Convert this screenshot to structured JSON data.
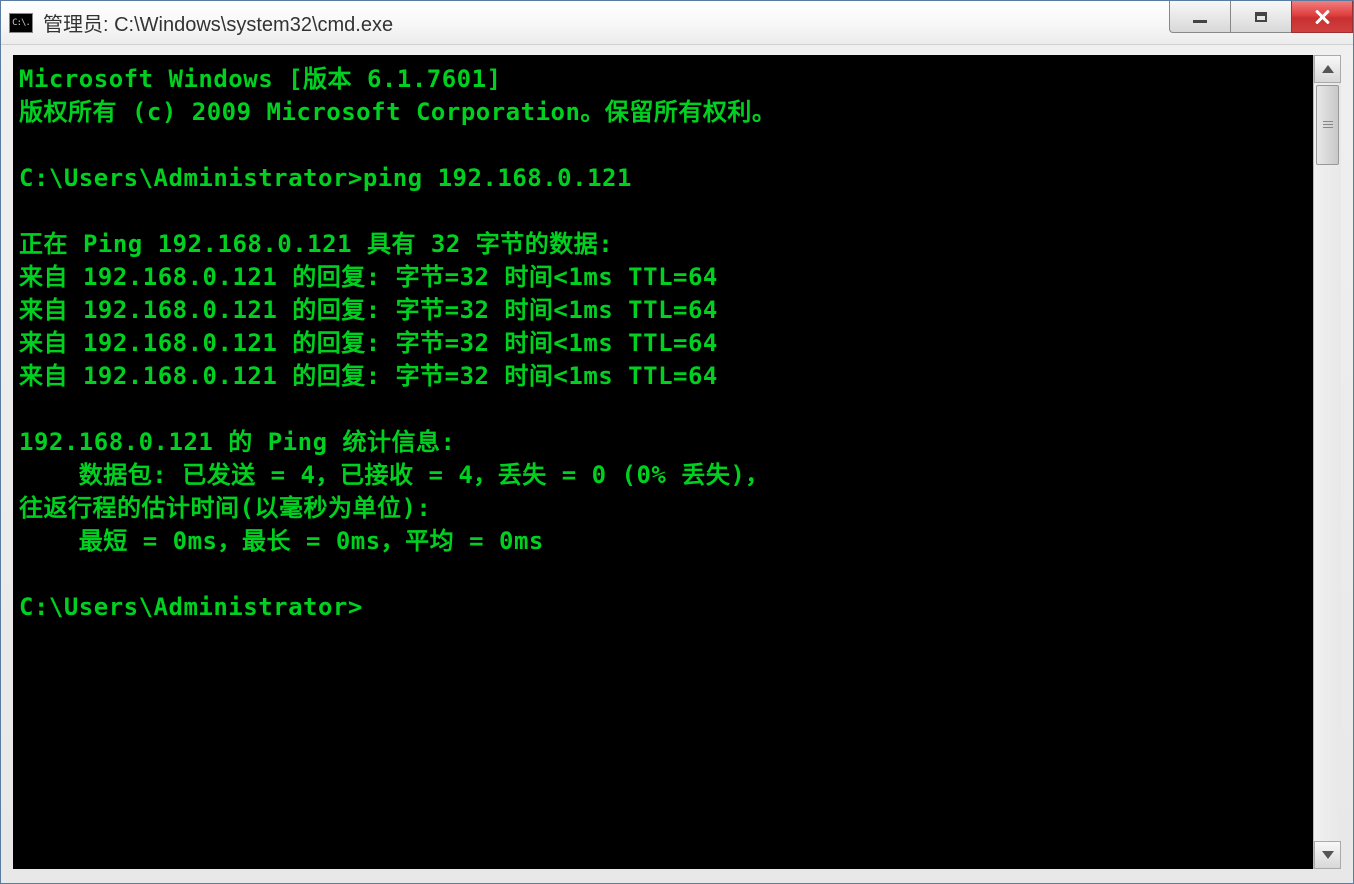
{
  "window": {
    "icon_text": "C:\\.",
    "title": "管理员: C:\\Windows\\system32\\cmd.exe"
  },
  "terminal": {
    "lines": [
      "Microsoft Windows [版本 6.1.7601]",
      "版权所有 (c) 2009 Microsoft Corporation。保留所有权利。",
      "",
      "C:\\Users\\Administrator>ping 192.168.0.121",
      "",
      "正在 Ping 192.168.0.121 具有 32 字节的数据:",
      "来自 192.168.0.121 的回复: 字节=32 时间<1ms TTL=64",
      "来自 192.168.0.121 的回复: 字节=32 时间<1ms TTL=64",
      "来自 192.168.0.121 的回复: 字节=32 时间<1ms TTL=64",
      "来自 192.168.0.121 的回复: 字节=32 时间<1ms TTL=64",
      "",
      "192.168.0.121 的 Ping 统计信息:",
      "    数据包: 已发送 = 4，已接收 = 4，丢失 = 0 (0% 丢失)，",
      "往返行程的估计时间(以毫秒为单位):",
      "    最短 = 0ms，最长 = 0ms，平均 = 0ms",
      "",
      "C:\\Users\\Administrator>"
    ]
  }
}
